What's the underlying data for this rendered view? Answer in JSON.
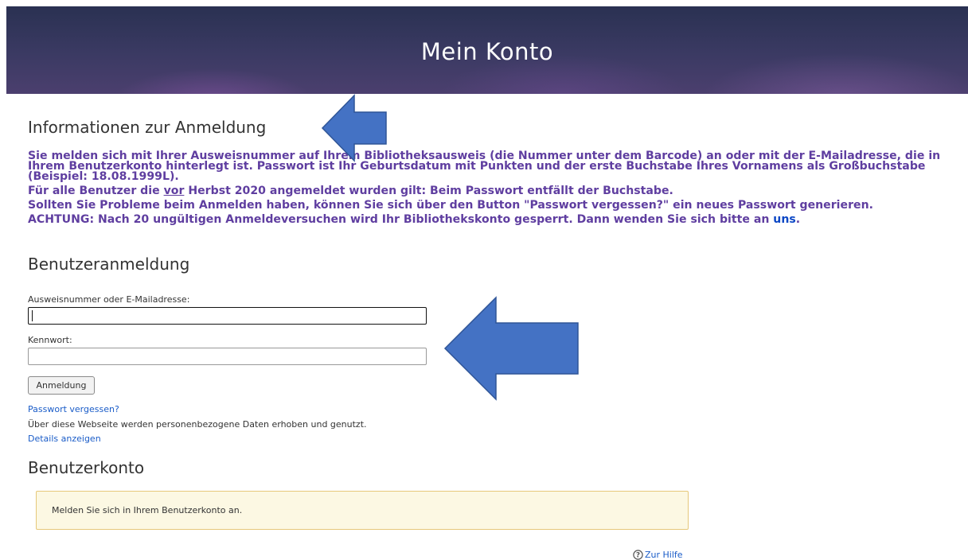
{
  "banner": {
    "title": "Mein Konto"
  },
  "info_section": {
    "heading": "Informationen zur Anmeldung",
    "para1": "Sie melden sich mit Ihrer Ausweisnummer auf Ihrem Bibliotheksausweis (die Nummer unter dem Barcode) an oder mit der E-Mailadresse, die in Ihrem Benutzerkonto hinterlegt ist. Passwort ist Ihr Geburtsdatum mit Punkten und der erste Buchstabe Ihres Vornamens als Großbuchstabe (Beispiel: 18.08.1999L).",
    "para2_before": "Für alle Benutzer die ",
    "para2_emph": "vor",
    "para2_after": " Herbst 2020 angemeldet wurden gilt: Beim Passwort entfällt der Buchstabe.",
    "para3": "Sollten Sie Probleme beim Anmelden haben, können Sie sich über den Button \"Passwort vergessen?\" ein neues Passwort generieren.",
    "para4_before": "ACHTUNG: Nach 20 ungültigen Anmeldeversuchen wird Ihr Bibliothekskonto gesperrt. Dann wenden Sie sich bitte an ",
    "para4_link": "uns",
    "para4_after": "."
  },
  "login": {
    "heading": "Benutzeranmeldung",
    "username_label": "Ausweisnummer oder E-Mailadresse:",
    "username_value": "",
    "password_label": "Kennwort:",
    "password_value": "",
    "submit_label": "Anmeldung",
    "forgot_link": "Passwort vergessen?",
    "privacy_note": "Über diese Webseite werden personenbezogene Daten erhoben und genutzt.",
    "details_link": "Details anzeigen"
  },
  "account": {
    "heading": "Benutzerkonto",
    "alert_text": "Melden Sie sich in Ihrem Benutzerkonto an."
  },
  "help": {
    "label": "Zur Hilfe",
    "icon": "help-circle-icon"
  },
  "colors": {
    "info_text": "#5f3ea0",
    "link": "#1a5cc8",
    "arrow_fill": "#4472c4",
    "alert_bg": "#fcf8e3",
    "alert_border": "#e6c87a"
  }
}
